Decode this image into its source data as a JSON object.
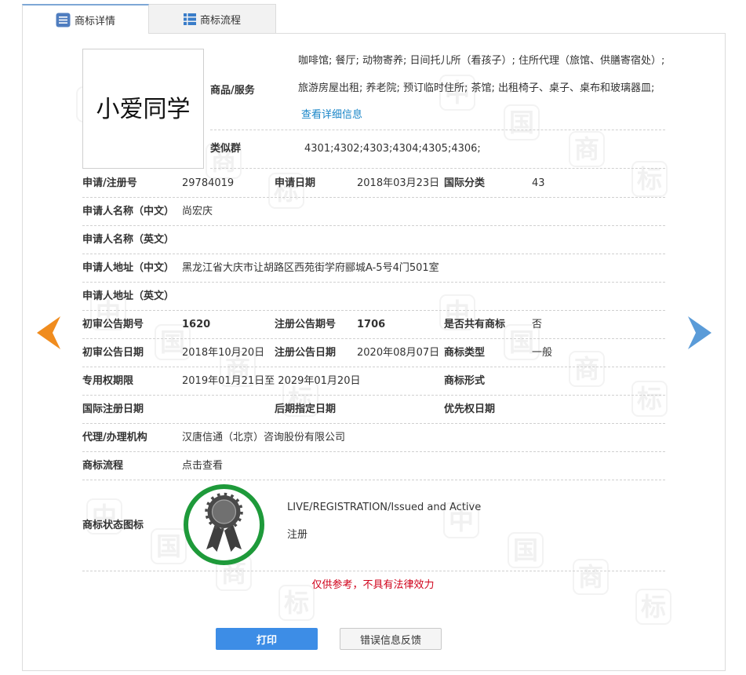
{
  "tabs": {
    "details": {
      "label": "商标详情",
      "icon": "document-list-icon",
      "active": true
    },
    "process": {
      "label": "商标流程",
      "icon": "table-list-icon",
      "active": false
    }
  },
  "trademark_image": {
    "text": "小爱同学"
  },
  "goods_services": {
    "label": "商品/服务",
    "text": "咖啡馆; 餐厅; 动物寄养; 日间托儿所（看孩子）; 住所代理（旅馆、供膳寄宿处）; 旅游房屋出租; 养老院; 预订临时住所; 茶馆; 出租椅子、桌子、桌布和玻璃器皿;",
    "link": "查看详细信息"
  },
  "similar_group": {
    "label": "类似群",
    "value": "4301;4302;4303;4304;4305;4306;"
  },
  "details": {
    "application_number": {
      "label": "申请/注册号",
      "value": "29784019"
    },
    "application_date": {
      "label": "申请日期",
      "value": "2018年03月23日"
    },
    "intl_class": {
      "label": "国际分类",
      "value": "43"
    },
    "applicant_name_cn": {
      "label": "申请人名称（中文）",
      "value": "尚宏庆"
    },
    "applicant_name_en": {
      "label": "申请人名称（英文）"
    },
    "applicant_addr_cn": {
      "label": "申请人地址（中文）",
      "value": "黑龙江省大庆市让胡路区西苑街学府郦城A-5号4门501室"
    },
    "applicant_addr_en": {
      "label": "申请人地址（英文）"
    },
    "prelim_pub_issue": {
      "label": "初审公告期号",
      "value": "1620"
    },
    "reg_pub_issue": {
      "label": "注册公告期号",
      "value": "1706"
    },
    "shared_mark": {
      "label": "是否共有商标",
      "value": "否"
    },
    "prelim_pub_date": {
      "label": "初审公告日期",
      "value": "2018年10月20日"
    },
    "reg_pub_date": {
      "label": "注册公告日期",
      "value": "2020年08月07日"
    },
    "mark_type": {
      "label": "商标类型",
      "value": "一般"
    },
    "exclusive_term": {
      "label": "专用权期限",
      "value": "2019年01月21日至 2029年01月20日"
    },
    "mark_form": {
      "label": "商标形式"
    },
    "intl_reg_date": {
      "label": "国际注册日期"
    },
    "later_designation_date": {
      "label": "后期指定日期"
    },
    "priority_date": {
      "label": "优先权日期"
    },
    "agency": {
      "label": "代理/办理机构",
      "value": "汉唐信通（北京）咨询股份有限公司"
    },
    "process": {
      "label": "商标流程",
      "value": "点击查看"
    }
  },
  "status": {
    "label": "商标状态图标",
    "icon": "registered-award-icon",
    "text_en": "LIVE/REGISTRATION/Issued and Active",
    "text_cn": "注册"
  },
  "disclaimer": "仅供参考，不具有法律效力",
  "buttons": {
    "print": "打印",
    "feedback": "错误信息反馈"
  },
  "nav": {
    "prev_icon": "chevron-left-icon",
    "next_icon": "chevron-right-icon"
  },
  "watermark": [
    "中",
    "国",
    "商",
    "标"
  ],
  "colors": {
    "link": "#1a86c8",
    "primary_button": "#3d8de6",
    "status_ring": "#1e9a3a",
    "prev_arrow": "#f08c1e",
    "next_arrow": "#5a9bd8",
    "disclaimer": "#d0021b"
  }
}
